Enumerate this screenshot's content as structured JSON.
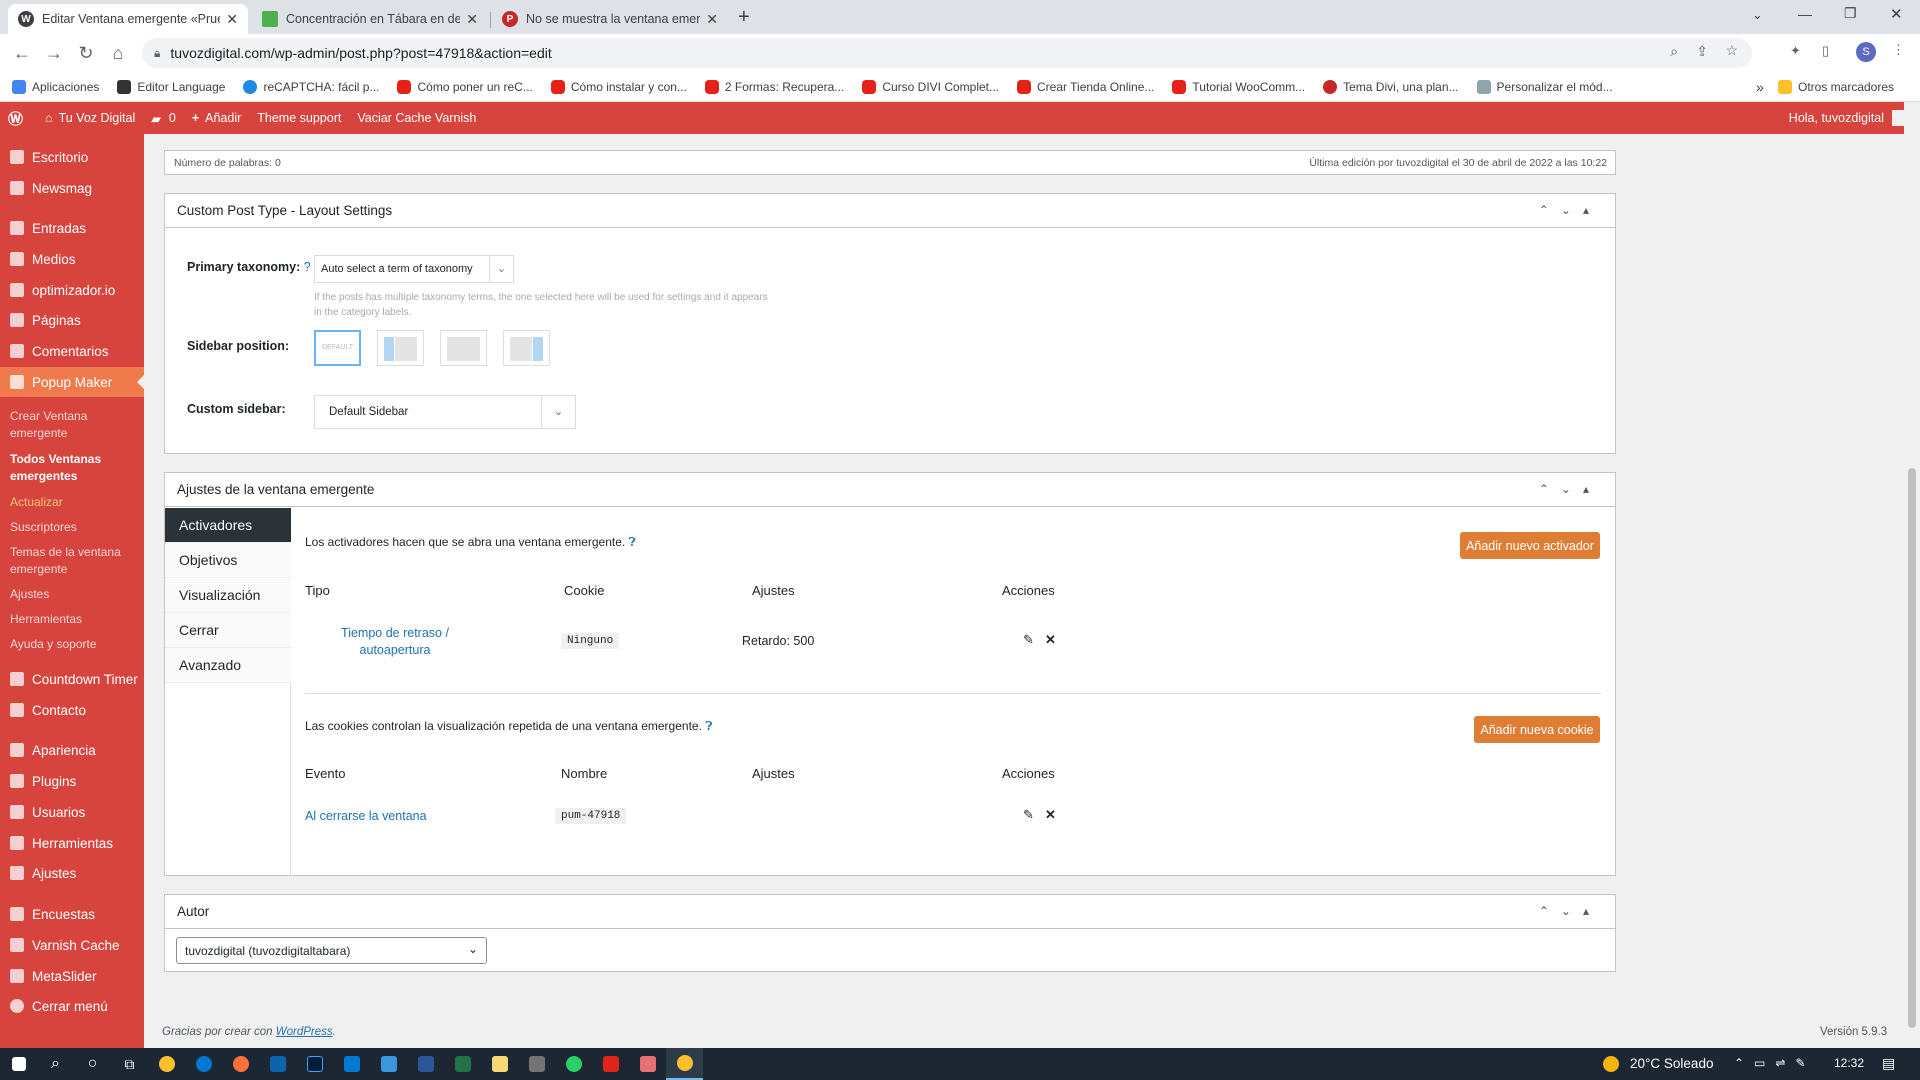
{
  "browser": {
    "tabs": [
      {
        "title": "Editar Ventana emergente «Prue",
        "active": true,
        "icon": "wordpress-icon"
      },
      {
        "title": "Concentración en Tábara en defe",
        "active": false,
        "icon": "doc-icon"
      },
      {
        "title": "No se muestra la ventana emerg",
        "active": false,
        "icon": "popup-maker-icon"
      }
    ],
    "url": "tuvozdigital.com/wp-admin/post.php?post=47918&action=edit",
    "bookmarks": [
      "Aplicaciones",
      "Editor Language",
      "reCAPTCHA: fácil p...",
      "Cómo poner un reC...",
      "Cómo instalar y con...",
      "2 Formas: Recupera...",
      "Curso DIVI Complet...",
      "Crear Tienda Online...",
      "Tutorial WooComm...",
      "Tema Divi, una plan...",
      "Personalizar el mód..."
    ],
    "other_bookmarks": "Otros marcadores",
    "more": "»"
  },
  "adminbar": {
    "site": "Tu Voz Digital",
    "comments": "0",
    "add": "Añadir",
    "theme_support": "Theme support",
    "cache": "Vaciar Cache Varnish",
    "greeting": "Hola, tuvozdigital"
  },
  "sidebar": {
    "items": [
      "Escritorio",
      "Newsmag",
      "Entradas",
      "Medios",
      "optimizador.io",
      "Páginas",
      "Comentarios",
      "Popup Maker",
      "Countdown Timer",
      "Contacto",
      "Apariencia",
      "Plugins",
      "Usuarios",
      "Herramientas",
      "Ajustes",
      "Encuestas",
      "Varnish Cache",
      "MetaSlider",
      "Cerrar menú"
    ],
    "submenu": [
      "Crear Ventana emergente",
      "Todos Ventanas emergentes",
      "Actualizar",
      "Suscriptores",
      "Temas de la ventana emergente",
      "Ajustes",
      "Herramientas",
      "Ayuda y soporte"
    ]
  },
  "editor": {
    "word_count": "Número de palabras: 0",
    "last_edit": "Última edición por tuvozdigital el 30 de abril de 2022 a las 10:22"
  },
  "layout_box": {
    "title": "Custom Post Type - Layout Settings",
    "primary_taxonomy_label": "Primary taxonomy:",
    "help": "?",
    "taxonomy_value": "Auto select a term of taxonomy",
    "taxonomy_hint_1": "If the posts has multiple taxonomy terms, the one selected here will be used for settings and it appears",
    "taxonomy_hint_2": "in the category labels.",
    "sidebar_position_label": "Sidebar position:",
    "default_option": "DEFAULT",
    "custom_sidebar_label": "Custom sidebar:",
    "custom_sidebar_value": "Default Sidebar"
  },
  "popup_box": {
    "title": "Ajustes de la ventana emergente",
    "tabs": [
      "Activadores",
      "Objetivos",
      "Visualización",
      "Cerrar",
      "Avanzado"
    ],
    "triggers_intro": "Los activadores hacen que se abra una ventana emergente.",
    "add_trigger": "Añadir nuevo activador",
    "trigger_headers": [
      "Tipo",
      "Cookie",
      "Ajustes",
      "Acciones"
    ],
    "trigger_row": {
      "type": "Tiempo de retraso / autoapertura",
      "cookie": "Ninguno",
      "settings": "Retardo: 500"
    },
    "cookies_intro": "Las cookies controlan la visualización repetida de una ventana emergente.",
    "add_cookie": "Añadir nueva cookie",
    "cookie_headers": [
      "Evento",
      "Nombre",
      "Ajustes",
      "Acciones"
    ],
    "cookie_row": {
      "event": "Al cerrarse la ventana",
      "name": "pum-47918"
    }
  },
  "author_box": {
    "title": "Autor",
    "value": "tuvozdigital (tuvozdigitaltabara)"
  },
  "footer": {
    "thanks": "Gracias por crear con",
    "wp": "WordPress",
    "version": "Versión 5.9.3"
  },
  "taskbar": {
    "weather": "20°C  Soleado",
    "time": "12:32"
  },
  "colors": {
    "admin_red": "#d7443e",
    "accent_orange": "#e07d34",
    "link_blue": "#2271b1"
  }
}
